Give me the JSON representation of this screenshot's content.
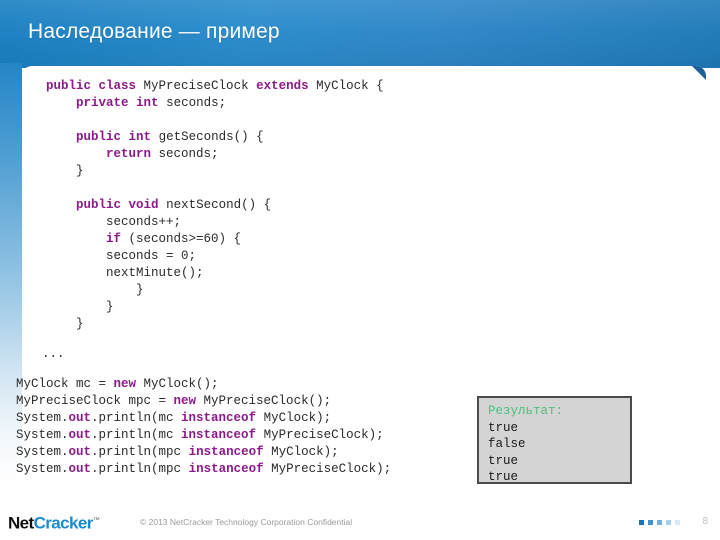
{
  "slide": {
    "title": "Наследование — пример",
    "page_number": "8",
    "accent_color": "#2585c6",
    "panel_color": "#ffffff"
  },
  "code_top": {
    "keyword_color": "#8b1a8b",
    "lines": [
      [
        {
          "t": "public",
          "k": true
        },
        {
          "t": " ",
          "k": false
        },
        {
          "t": "class",
          "k": true
        },
        {
          "t": " MyPreciseClock ",
          "k": false
        },
        {
          "t": "extends",
          "k": true
        },
        {
          "t": " MyClock {",
          "k": false
        }
      ],
      [
        {
          "t": "    ",
          "k": false
        },
        {
          "t": "private",
          "k": true
        },
        {
          "t": " ",
          "k": false
        },
        {
          "t": "int",
          "k": true
        },
        {
          "t": " seconds;",
          "k": false
        }
      ],
      [
        {
          "t": "",
          "k": false
        }
      ],
      [
        {
          "t": "    ",
          "k": false
        },
        {
          "t": "public",
          "k": true
        },
        {
          "t": " ",
          "k": false
        },
        {
          "t": "int",
          "k": true
        },
        {
          "t": " getSeconds() {",
          "k": false
        }
      ],
      [
        {
          "t": "        ",
          "k": false
        },
        {
          "t": "return",
          "k": true
        },
        {
          "t": " seconds;",
          "k": false
        }
      ],
      [
        {
          "t": "    }",
          "k": false
        }
      ],
      [
        {
          "t": "",
          "k": false
        }
      ],
      [
        {
          "t": "    ",
          "k": false
        },
        {
          "t": "public",
          "k": true
        },
        {
          "t": " ",
          "k": false
        },
        {
          "t": "void",
          "k": true
        },
        {
          "t": " nextSecond() {",
          "k": false
        }
      ],
      [
        {
          "t": "        seconds++;",
          "k": false
        }
      ],
      [
        {
          "t": "        ",
          "k": false
        },
        {
          "t": "if",
          "k": true
        },
        {
          "t": " (seconds>=60) {",
          "k": false
        }
      ],
      [
        {
          "t": "        seconds = 0;",
          "k": false
        }
      ],
      [
        {
          "t": "        nextMinute();",
          "k": false
        }
      ],
      [
        {
          "t": "            }",
          "k": false
        }
      ],
      [
        {
          "t": "        }",
          "k": false
        }
      ],
      [
        {
          "t": "    }",
          "k": false
        }
      ]
    ]
  },
  "ellipsis": "...",
  "code_bottom": {
    "lines": [
      [
        {
          "t": "MyClock mc = ",
          "k": false
        },
        {
          "t": "new",
          "k": true
        },
        {
          "t": " MyClock();",
          "k": false
        }
      ],
      [
        {
          "t": "MyPreciseClock mpc = ",
          "k": false
        },
        {
          "t": "new",
          "k": true
        },
        {
          "t": " MyPreciseClock();",
          "k": false
        }
      ],
      [
        {
          "t": "System.",
          "k": false
        },
        {
          "t": "out",
          "k": true
        },
        {
          "t": ".println(mc ",
          "k": false
        },
        {
          "t": "instanceof",
          "k": true
        },
        {
          "t": " MyClock);",
          "k": false
        }
      ],
      [
        {
          "t": "System.",
          "k": false
        },
        {
          "t": "out",
          "k": true
        },
        {
          "t": ".println(mc ",
          "k": false
        },
        {
          "t": "instanceof",
          "k": true
        },
        {
          "t": " MyPreciseClock);",
          "k": false
        }
      ],
      [
        {
          "t": "System.",
          "k": false
        },
        {
          "t": "out",
          "k": true
        },
        {
          "t": ".println(mpc ",
          "k": false
        },
        {
          "t": "instanceof",
          "k": true
        },
        {
          "t": " MyClock);",
          "k": false
        }
      ],
      [
        {
          "t": "System.",
          "k": false
        },
        {
          "t": "out",
          "k": true
        },
        {
          "t": ".println(mpc ",
          "k": false
        },
        {
          "t": "instanceof",
          "k": true
        },
        {
          "t": " MyPreciseClock);",
          "k": false
        }
      ]
    ]
  },
  "result_box": {
    "title": "Результат:",
    "title_color": "#4fbf7f",
    "values": [
      "true",
      "false",
      "true",
      "true"
    ]
  },
  "footer": {
    "logo_part1": "Net",
    "logo_part2": "Cracker",
    "logo_tm": "™",
    "copyright": "© 2013 NetCracker Technology Corporation Confidential",
    "dots": [
      "#1d73b5",
      "#3f93cf",
      "#6fb0df",
      "#a6cfec",
      "#d9e9f6"
    ]
  }
}
